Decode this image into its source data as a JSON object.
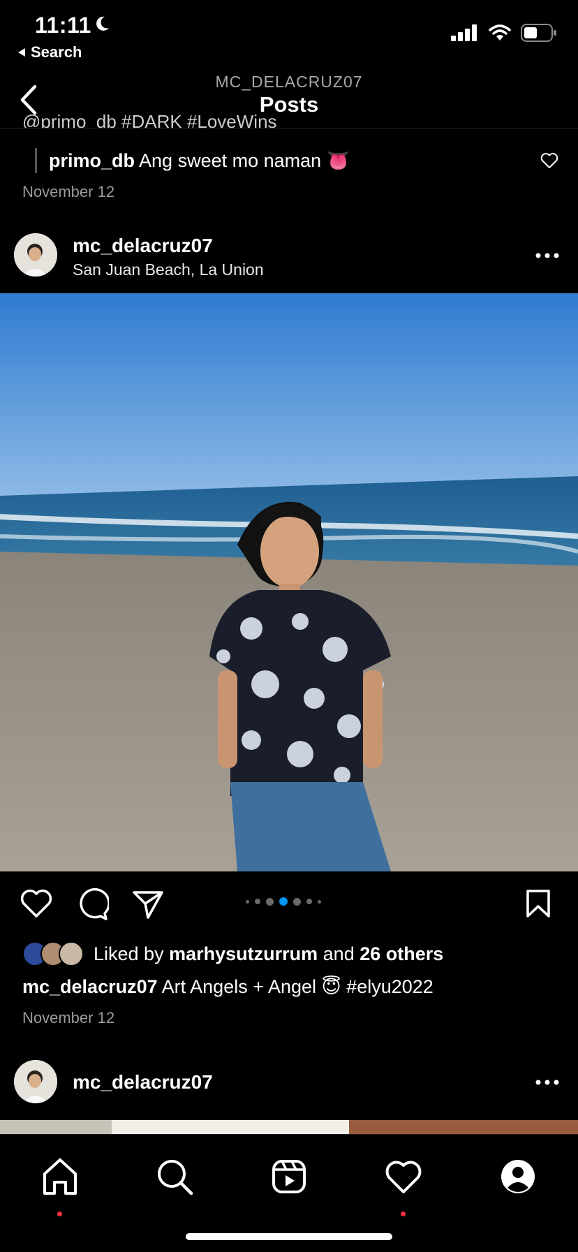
{
  "status": {
    "time": "11:11",
    "back_label": "Search"
  },
  "nav": {
    "subtitle": "MC_DELACRUZ07",
    "title": "Posts"
  },
  "prev_post": {
    "cut_caption": "@primo_db #DARK #LoveWins",
    "reply": {
      "username": "primo_db",
      "text": "Ang sweet mo naman 👅"
    },
    "date": "November 12"
  },
  "post": {
    "username": "mc_delacruz07",
    "location": "San Juan Beach, La Union",
    "carousel": {
      "count": 6,
      "active_index": 2
    },
    "liked_by": {
      "prefix": "Liked by",
      "user": "marhysutzurrum",
      "and": "and",
      "others": "26 others"
    },
    "caption": {
      "username": "mc_delacruz07",
      "text": "Art Angels + Angel 😇 #elyu2022"
    },
    "date": "November 12"
  },
  "next_post": {
    "username": "mc_delacruz07"
  },
  "tabbar": {
    "items": [
      "home-icon",
      "search-icon",
      "reels-icon",
      "heart-icon",
      "profile-icon"
    ]
  },
  "colors": {
    "background": "#000000",
    "notification": "#ff3040",
    "sky": "#3f86d6",
    "sea": "#2e6a9a",
    "sand": "#9e978a"
  }
}
